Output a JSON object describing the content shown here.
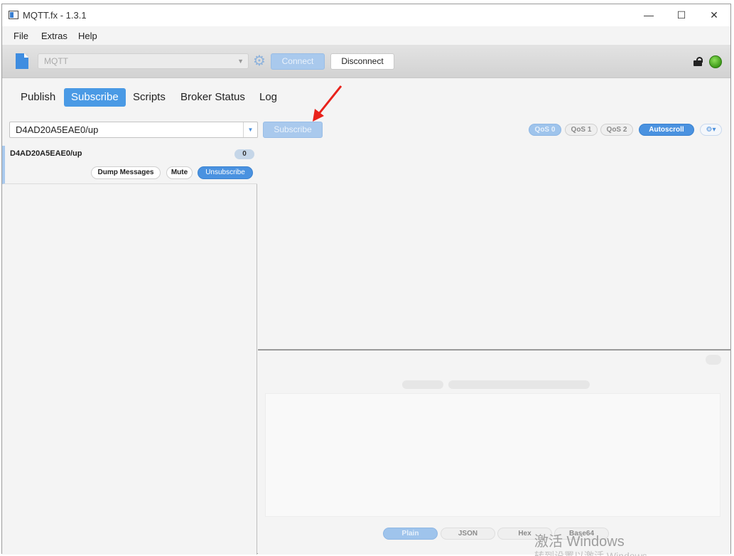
{
  "window": {
    "title": "MQTT.fx - 1.3.1"
  },
  "menu": {
    "file": "File",
    "extras": "Extras",
    "help": "Help"
  },
  "toolbar": {
    "profile_value": "MQTT",
    "connect_label": "Connect",
    "disconnect_label": "Disconnect"
  },
  "tabs": [
    {
      "label": "Publish"
    },
    {
      "label": "Subscribe"
    },
    {
      "label": "Scripts"
    },
    {
      "label": "Broker Status"
    },
    {
      "label": "Log"
    }
  ],
  "subscribe": {
    "topic_value": "D4AD20A5EAE0/up",
    "subscribe_label": "Subscribe",
    "qos": [
      "QoS 0",
      "QoS 1",
      "QoS 2"
    ],
    "autoscroll_label": "Autoscroll"
  },
  "subscriptions": [
    {
      "topic": "D4AD20A5EAE0/up",
      "count": "0",
      "dump_label": "Dump Messages",
      "mute_label": "Mute",
      "unsubscribe_label": "Unsubscribe"
    }
  ],
  "payload_formats": [
    "Plain",
    "JSON",
    "Hex",
    "Base64"
  ],
  "watermark": {
    "line1": "激活 Windows",
    "line2": "转到设置以激活 Windows"
  },
  "colors": {
    "accent": "#4a9ae5",
    "disabled_accent": "#a9c9ed",
    "status_connected": "#3d9a19",
    "annotation_arrow": "#e8221b"
  }
}
